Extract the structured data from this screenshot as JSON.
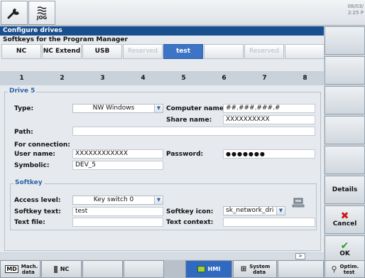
{
  "top": {
    "jog_label": "JOG",
    "datetime_line1": "08/03/",
    "datetime_line2": "2:25 P"
  },
  "header": {
    "title": "Configure drives",
    "subtitle": "Softkeys for the Program Manager"
  },
  "tabs": [
    {
      "label": "NC",
      "num": "1",
      "state": "normal"
    },
    {
      "label": "NC Extend",
      "num": "2",
      "state": "normal"
    },
    {
      "label": "USB",
      "num": "3",
      "state": "normal"
    },
    {
      "label": "Reserved",
      "num": "4",
      "state": "disabled"
    },
    {
      "label": "test",
      "num": "5",
      "state": "active"
    },
    {
      "label": "",
      "num": "6",
      "state": "normal"
    },
    {
      "label": "Reserved",
      "num": "7",
      "state": "disabled"
    },
    {
      "label": "",
      "num": "8",
      "state": "normal"
    }
  ],
  "drive": {
    "group_title": "Drive 5",
    "type_label": "Type:",
    "type_value": "NW Windows",
    "computer_name_label": "Computer name:",
    "computer_name_value": "##.###.###.#",
    "share_name_label": "Share name:",
    "share_name_value": "XXXXXXXXXX",
    "path_label": "Path:",
    "path_value": "",
    "for_connection_label": "For connection:",
    "user_name_label": "User name:",
    "user_name_value": "XXXXXXXXXXXX",
    "password_label": "Password:",
    "password_value": "●●●●●●●",
    "symbolic_label": "Symbolic:",
    "symbolic_value": "DEV_5"
  },
  "softkey": {
    "group_title": "Softkey",
    "access_level_label": "Access level:",
    "access_level_value": "Key switch 0",
    "softkey_text_label": "Softkey text:",
    "softkey_text_value": "test",
    "softkey_icon_label": "Softkey icon:",
    "softkey_icon_value": "sk_network_dri",
    "text_file_label": "Text file:",
    "text_file_value": "",
    "text_context_label": "Text context:",
    "text_context_value": ""
  },
  "vertical_softkeys": {
    "details": "Details",
    "cancel": "Cancel",
    "ok": "OK"
  },
  "horizontal_softkeys": {
    "mach_data": "Mach. data",
    "nc": "NC",
    "hmi": "HMI",
    "system_data": "System data",
    "optim_test": "Optim. test"
  },
  "colors": {
    "title_bar": "#1a4f8f",
    "active_tab": "#3e74c5",
    "cancel_red": "#d01818",
    "ok_green": "#2aa02a"
  }
}
